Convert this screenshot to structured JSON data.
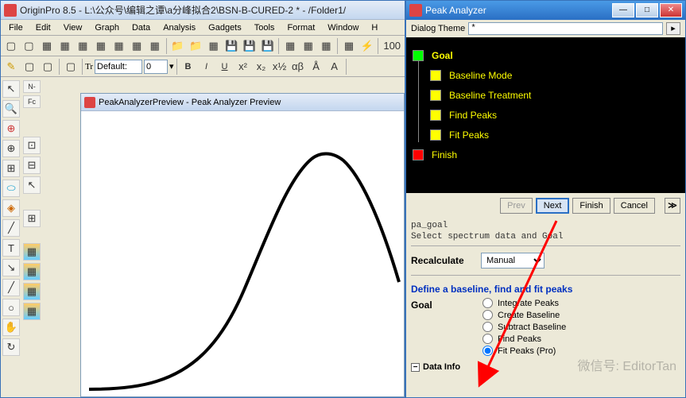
{
  "main": {
    "title": "OriginPro 8.5 - L:\\公众号\\编辑之谭\\a分峰拟合2\\BSN-B-CURED-2 * - /Folder1/",
    "menu": [
      "File",
      "Edit",
      "View",
      "Graph",
      "Data",
      "Analysis",
      "Gadgets",
      "Tools",
      "Format",
      "Window",
      "H"
    ],
    "font_label": "Default:",
    "font_size": "0",
    "toolbar_btn": "100"
  },
  "preview": {
    "title": "PeakAnalyzerPreview - Peak Analyzer Preview"
  },
  "pa": {
    "title": "Peak Analyzer",
    "theme_label": "Dialog Theme",
    "theme_value": "*",
    "tree": {
      "goal": "Goal",
      "baseline_mode": "Baseline Mode",
      "baseline_treatment": "Baseline Treatment",
      "find_peaks": "Find Peaks",
      "fit_peaks": "Fit Peaks",
      "finish": "Finish"
    },
    "buttons": {
      "prev": "Prev",
      "next": "Next",
      "finish": "Finish",
      "cancel": "Cancel"
    },
    "goal_code": "pa_goal",
    "goal_desc": "Select spectrum data and Goal",
    "recalc_label": "Recalculate",
    "recalc_value": "Manual",
    "define_header": "Define a baseline, find and fit peaks",
    "goal_label": "Goal",
    "radios": {
      "integrate": "Integrate Peaks",
      "create": "Create Baseline",
      "subtract": "Subtract Baseline",
      "find": "Find Peaks",
      "fit": "Fit Peaks (Pro)"
    },
    "data_info": "Data Info"
  },
  "watermark": "微信号: EditorTan"
}
